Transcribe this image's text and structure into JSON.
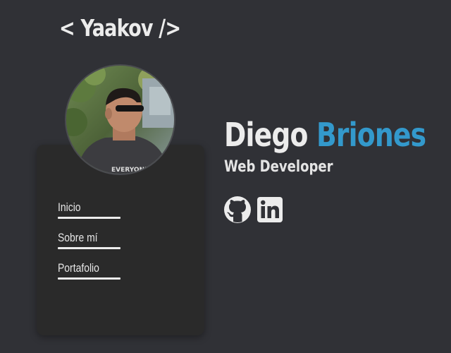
{
  "brand": {
    "logo_text": "< Yaakov />"
  },
  "profile": {
    "avatar_icon": "profile-photo"
  },
  "nav": {
    "items": [
      {
        "label": "Inicio"
      },
      {
        "label": "Sobre mí"
      },
      {
        "label": "Portafolio"
      }
    ]
  },
  "hero": {
    "first_name": "Diego",
    "last_name": "Briones",
    "role": "Web Developer"
  },
  "socials": [
    {
      "icon": "github-icon"
    },
    {
      "icon": "linkedin-icon"
    }
  ],
  "colors": {
    "background": "#303136",
    "sidebar": "#2a2a2a",
    "accent": "#3399cc",
    "text": "#ececec"
  }
}
